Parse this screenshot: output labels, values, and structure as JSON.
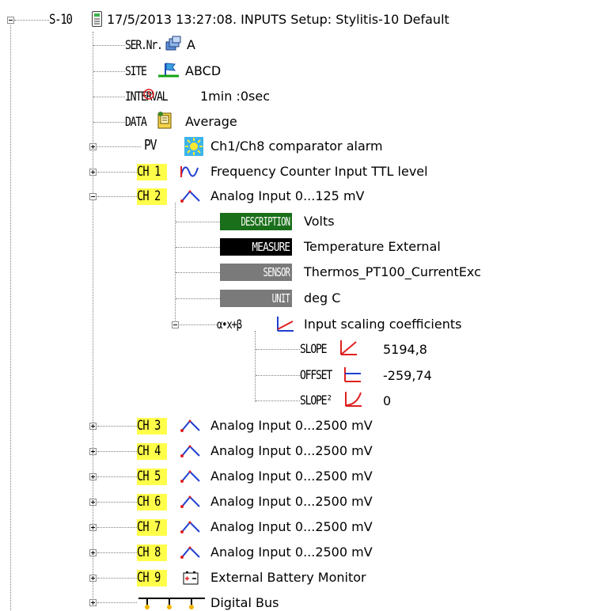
{
  "root": {
    "device": "S-10",
    "title": "17/5/2013 13:27:08. INPUTS Setup: Stylitis-10 Default"
  },
  "info": [
    {
      "tag": "SER.Nr.",
      "value": "A",
      "icon": "serial-number-icon"
    },
    {
      "tag": "SITE",
      "value": "ABCD",
      "icon": "site-flag-icon"
    },
    {
      "tag": "INTERVAL",
      "value": "1min :0sec",
      "icon": "clock-icon"
    },
    {
      "tag": "DATA",
      "value": "Average",
      "icon": "data-book-icon"
    },
    {
      "tag": "PV",
      "value": "Ch1/Ch8 comparator alarm",
      "icon": "sun-icon"
    }
  ],
  "ch1": {
    "tag": "CH 1",
    "label": "Frequency Counter Input TTL level",
    "icon": "frequency-wave-icon"
  },
  "ch2": {
    "tag": "CH 2",
    "label": "Analog Input 0...125 mV",
    "icon": "analog-wave-icon",
    "props": [
      {
        "tag": "DESCRIPTION",
        "value": "Volts",
        "color": "#1a6f1a"
      },
      {
        "tag": "MEASURE",
        "value": "Temperature External",
        "color": "#000000"
      },
      {
        "tag": "SENSOR",
        "value": "Thermos_PT100_CurrentExc",
        "color": "#808080"
      },
      {
        "tag": "UNIT",
        "value": "deg C",
        "color": "#808080"
      }
    ],
    "scaling": {
      "tag": "α•x+β",
      "label": "Input scaling coefficients",
      "items": [
        {
          "tag": "SLOPE",
          "value": "5194,8",
          "icon": "slope-icon"
        },
        {
          "tag": "OFFSET",
          "value": "-259,74",
          "icon": "offset-icon"
        },
        {
          "tag": "SLOPE²",
          "value": "0",
          "icon": "slope-squared-icon"
        }
      ]
    }
  },
  "channels": [
    {
      "tag": "CH 3",
      "label": "Analog Input 0...2500 mV"
    },
    {
      "tag": "CH 4",
      "label": "Analog Input 0...2500 mV"
    },
    {
      "tag": "CH 5",
      "label": "Analog Input 0...2500 mV"
    },
    {
      "tag": "CH 6",
      "label": "Analog Input 0...2500 mV"
    },
    {
      "tag": "CH 7",
      "label": "Analog Input 0...2500 mV"
    },
    {
      "tag": "CH 8",
      "label": "Analog Input 0...2500 mV"
    }
  ],
  "ch9": {
    "tag": "CH 9",
    "label": "External Battery Monitor",
    "icon": "battery-icon"
  },
  "bus": {
    "label": "Digital Bus",
    "icon": "digital-bus-icon"
  }
}
